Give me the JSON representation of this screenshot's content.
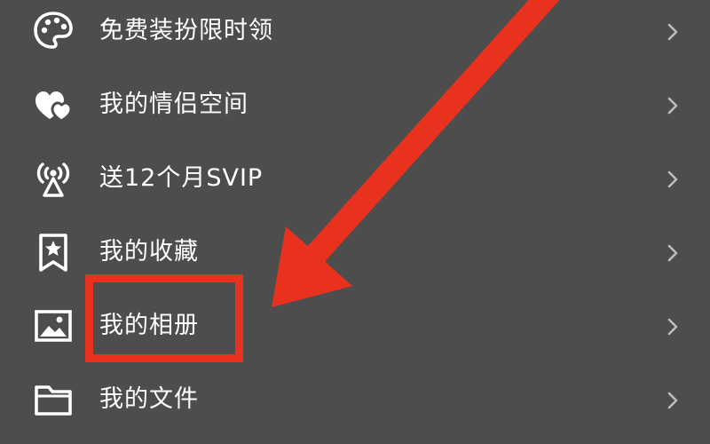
{
  "menu": {
    "items": [
      {
        "id": "free-dressup",
        "label": "免费装扮限时领",
        "icon": "palette-icon"
      },
      {
        "id": "couple-space",
        "label": "我的情侣空间",
        "icon": "hearts-icon"
      },
      {
        "id": "svip",
        "label": "送12个月SVIP",
        "icon": "broadcast-tower-icon"
      },
      {
        "id": "favorites",
        "label": "我的收藏",
        "icon": "bookmark-star-icon"
      },
      {
        "id": "album",
        "label": "我的相册",
        "icon": "image-icon"
      },
      {
        "id": "files",
        "label": "我的文件",
        "icon": "folder-icon"
      }
    ],
    "chevron_icon": "chevron-right-icon"
  },
  "annotation": {
    "highlighted_item": "我的相册",
    "color": "#e8321e"
  },
  "colors": {
    "background": "#4d4d4d",
    "text": "#ffffff",
    "chevron": "#bdbdbd",
    "annotation": "#e8321e"
  }
}
